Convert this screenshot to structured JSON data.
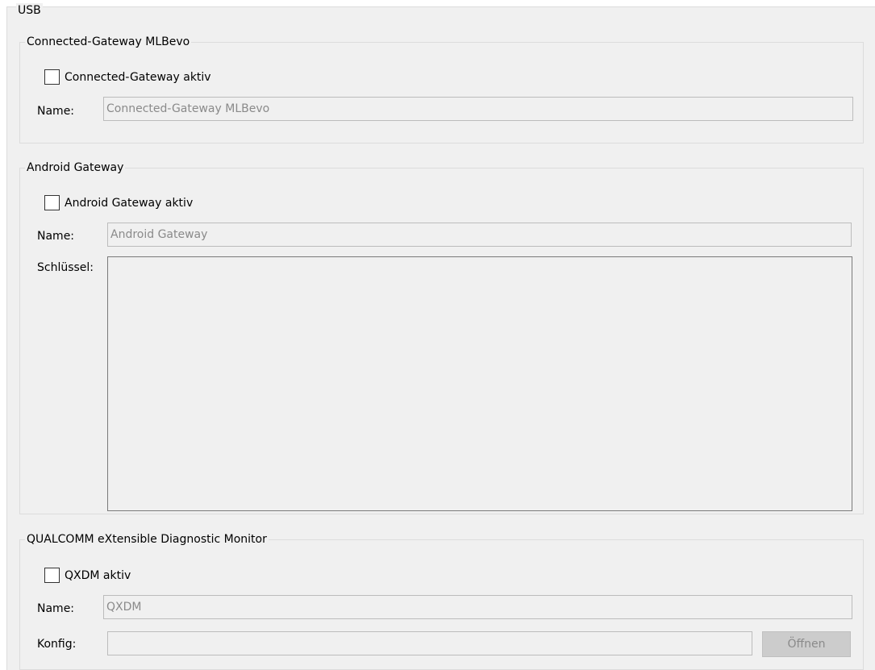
{
  "usb": {
    "title": "USB"
  },
  "connected_gateway": {
    "group_title": "Connected-Gateway MLBevo",
    "checkbox_label": "Connected-Gateway aktiv",
    "checked": false,
    "name_label": "Name:",
    "name_value": "Connected-Gateway MLBevo"
  },
  "android_gateway": {
    "group_title": "Android Gateway",
    "checkbox_label": "Android Gateway aktiv",
    "checked": false,
    "name_label": "Name:",
    "name_value": "Android Gateway",
    "key_label": "Schlüssel:",
    "key_value": ""
  },
  "qxdm": {
    "group_title": "QUALCOMM eXtensible Diagnostic Monitor",
    "checkbox_label": "QXDM aktiv",
    "checked": false,
    "name_label": "Name:",
    "name_value": "QXDM",
    "config_label": "Konfig:",
    "config_value": "",
    "open_button": "Öffnen"
  }
}
